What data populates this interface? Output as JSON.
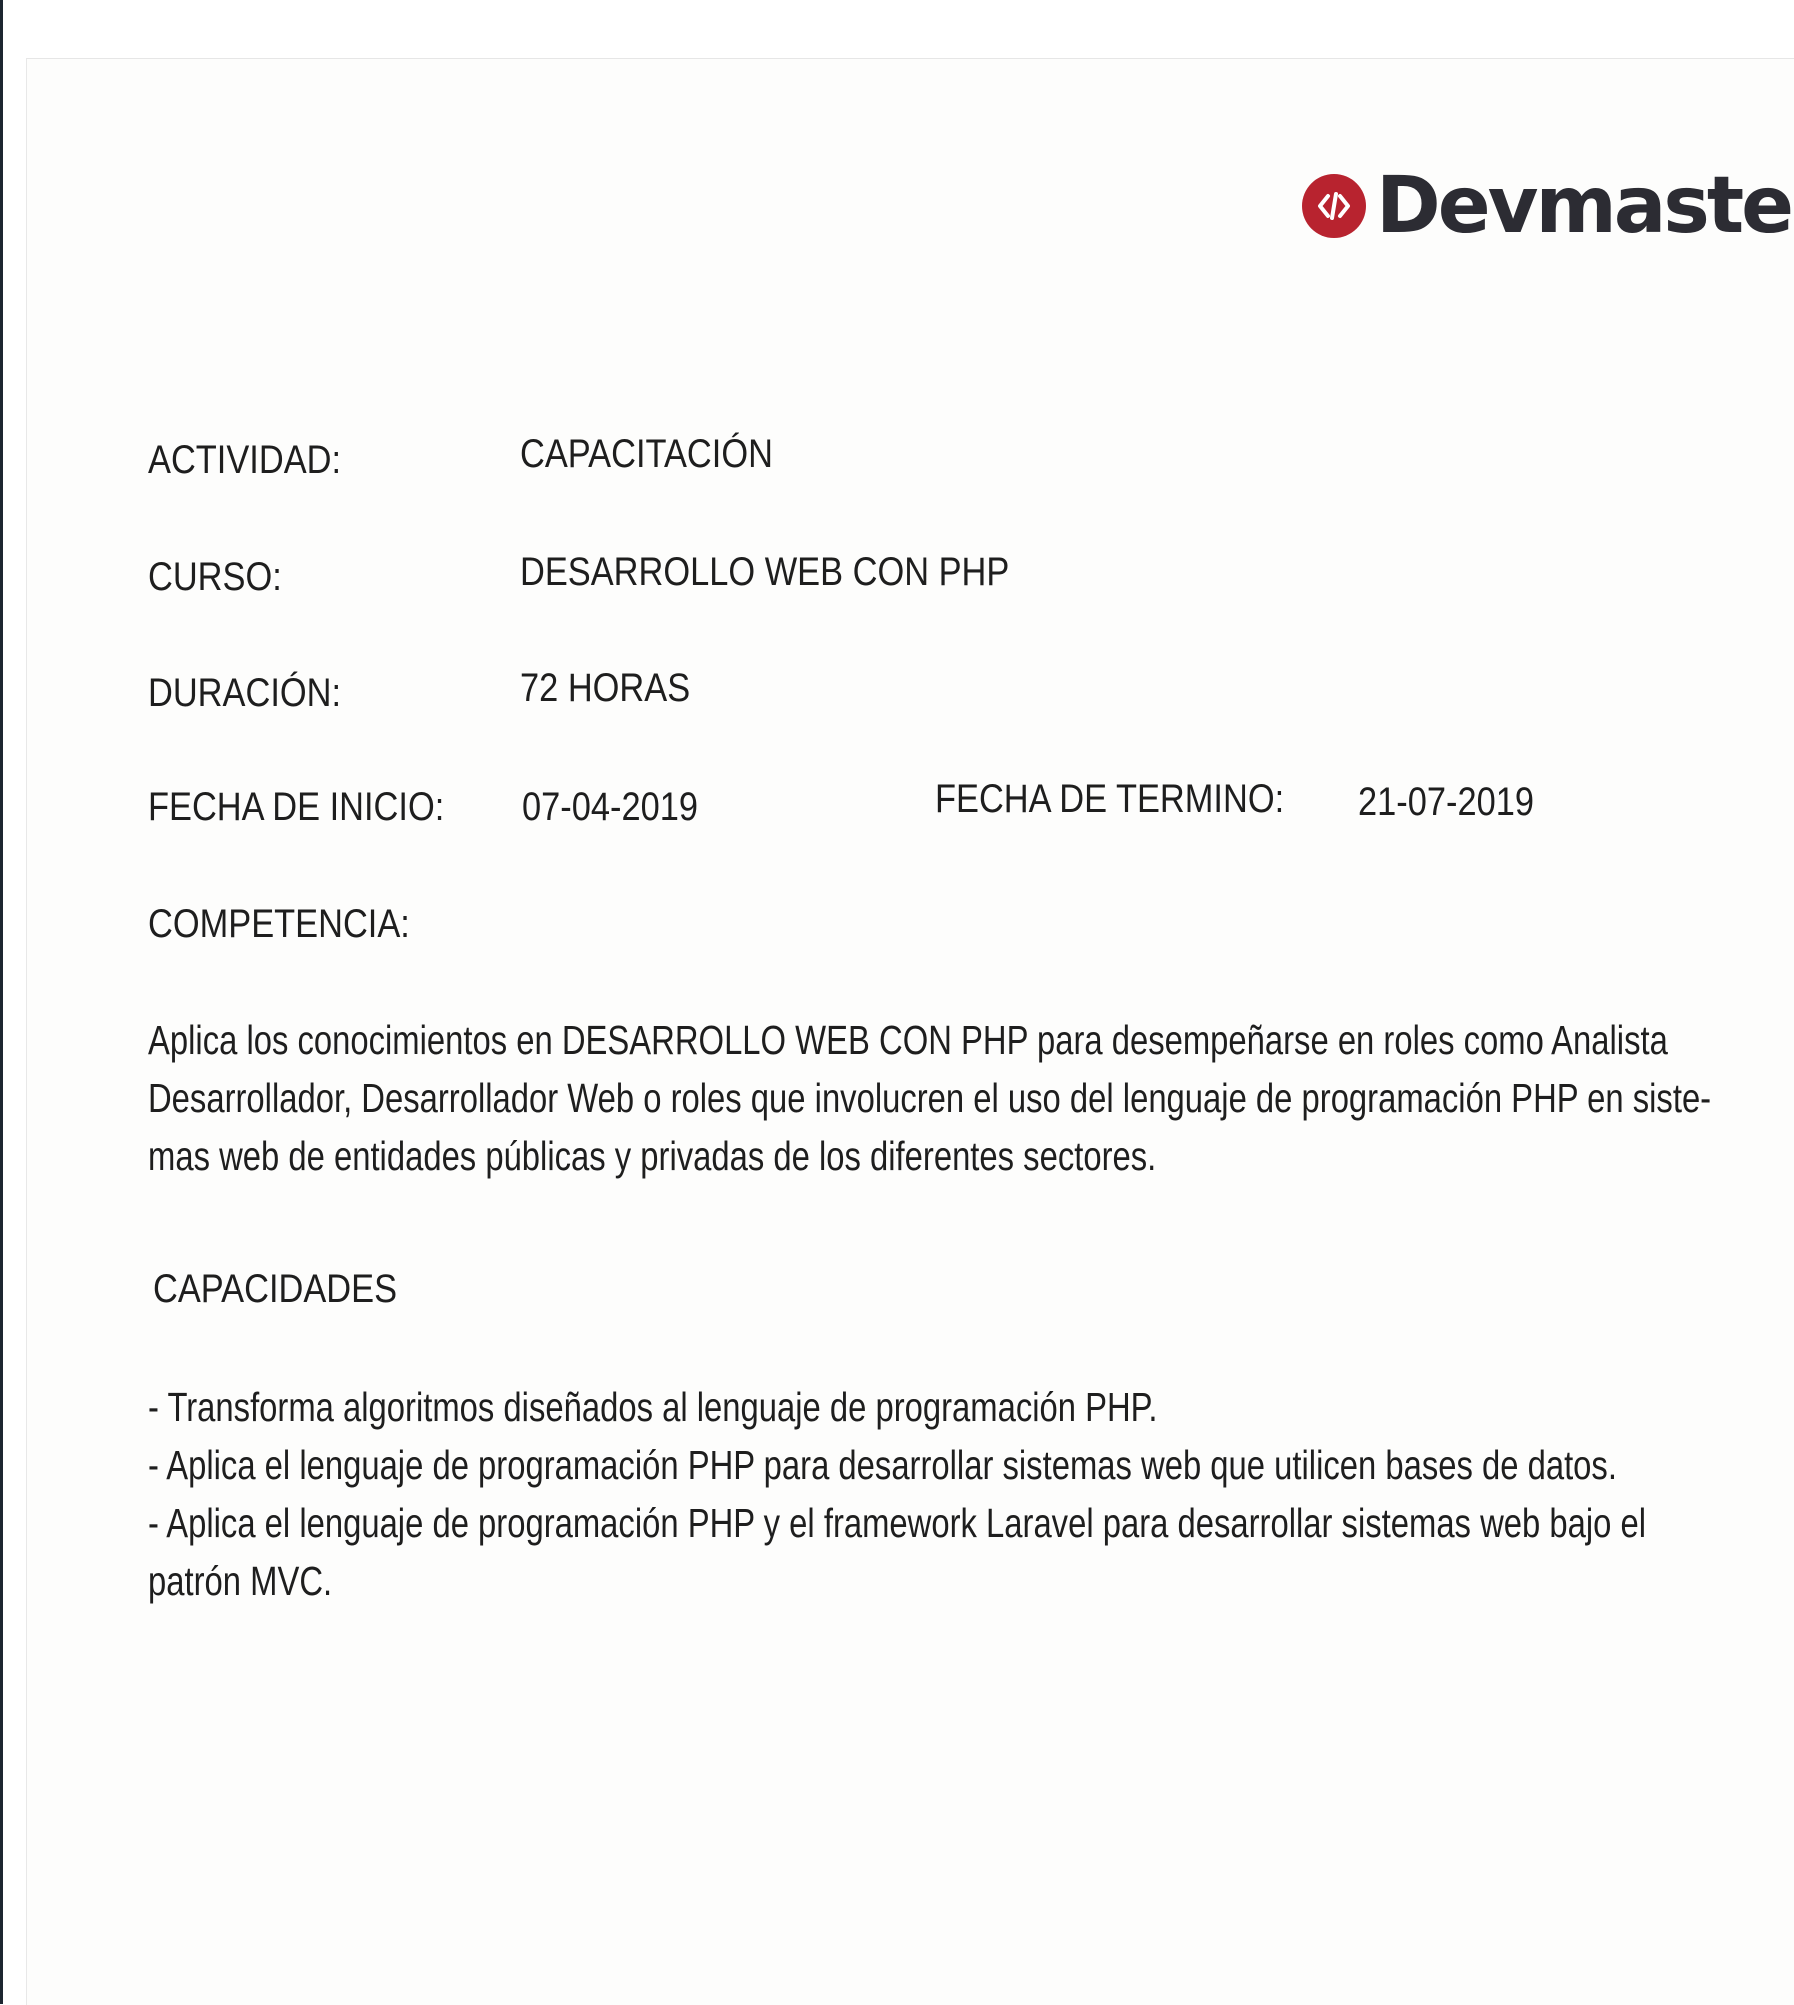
{
  "brand": {
    "name": "Devmaster",
    "logo_icon": "devmaster-logo-icon",
    "accent_color": "#b8232f"
  },
  "fields": {
    "actividad": {
      "label": "ACTIVIDAD:",
      "value": "CAPACITACIÓN"
    },
    "curso": {
      "label": "CURSO:",
      "value": "DESARROLLO WEB CON PHP"
    },
    "duracion": {
      "label": "DURACIÓN:",
      "value": "72 HORAS"
    },
    "fecha_inicio": {
      "label": "FECHA DE INICIO:",
      "value": "07-04-2019"
    },
    "fecha_termino": {
      "label": "FECHA DE TERMINO:",
      "value": "21-07-2019"
    }
  },
  "competencia": {
    "heading": "COMPETENCIA:",
    "lines": [
      "Aplica los conocimientos en DESARROLLO WEB CON PHP para desempeñarse en roles como Analista",
      "Desarrollador, Desarrollador Web o roles que involucren el uso del lenguaje de programación PHP en siste-",
      "mas web de entidades públicas y privadas de los diferentes sectores."
    ]
  },
  "capacidades": {
    "heading": "CAPACIDADES",
    "lines": [
      "- Transforma algoritmos diseñados al lenguaje de programación PHP.",
      "- Aplica el lenguaje de programación PHP para desarrollar sistemas web que utilicen bases de datos.",
      "- Aplica el lenguaje de programación PHP y el framework Laravel para desarrollar sistemas web bajo el",
      "patrón MVC."
    ]
  }
}
